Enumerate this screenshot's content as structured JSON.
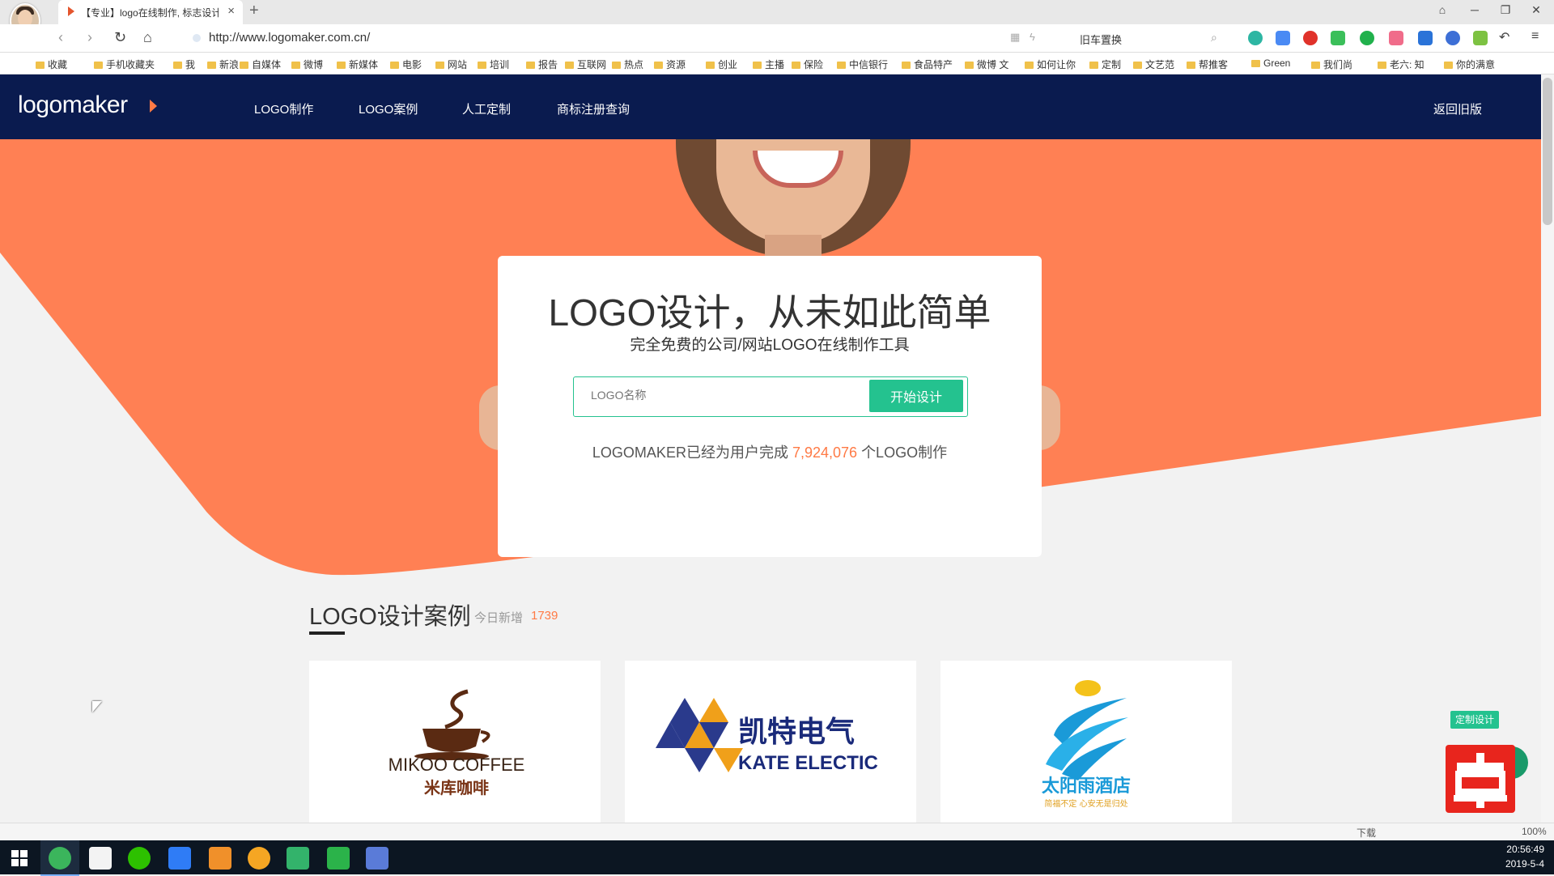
{
  "browser": {
    "tab_title": "【专业】logo在线制作, 标志设计",
    "tab_close": "×",
    "new_tab": "+",
    "url": "http://www.logomaker.com.cn/",
    "search_text": "旧车置换",
    "window_controls": {
      "pin": "⌂",
      "minimize": "─",
      "restore": "❐",
      "close": "✕"
    },
    "bookmarks": [
      "收藏",
      "手机收藏夹",
      "我",
      "新浪",
      "自媒体",
      "微博",
      "新媒体",
      "电影",
      "网站",
      "培训",
      "报告",
      "互联网",
      "热点",
      "资源",
      "创业",
      "主播",
      "保险",
      "中信银行",
      "食品特产",
      "微博 文",
      "如何让你",
      "定制",
      "文艺范",
      "帮推客",
      "Green",
      "我们尚",
      "老六: 知",
      "你的满意"
    ],
    "status": {
      "download": "下载",
      "zoom": "100%"
    }
  },
  "site": {
    "logo_text": "logomaker",
    "nav": [
      "LOGO制作",
      "LOGO案例",
      "人工定制",
      "商标注册查询"
    ],
    "old_version": "返回旧版",
    "colors": {
      "header_bg": "#0a1b4f",
      "accent_orange": "#ff7a45",
      "accent_green": "#24c28f"
    }
  },
  "hero": {
    "headline": "LOGO设计，从未如此简单",
    "subheadline": "完全免费的公司/网站LOGO在线制作工具",
    "input_placeholder": "LOGO名称",
    "start_button": "开始设计",
    "stats_prefix": "LOGOMAKER已经为用户完成",
    "stats_count": "7,924,076",
    "stats_suffix": "个LOGO制作"
  },
  "cases": {
    "title": "LOGO设计案例",
    "today_label": "今日新增",
    "today_count": "1739",
    "items": [
      {
        "brand_en": "MIKOO COFFEE",
        "brand_cn": "米库咖啡"
      },
      {
        "brand_cn": "凯特电气",
        "brand_en": "KATE ELECTIC"
      },
      {
        "brand_cn": "太阳雨酒店",
        "tagline": "简福不定 心安无是归处"
      }
    ]
  },
  "floating": {
    "custom_design": "定制设计"
  },
  "taskbar": {
    "time": "20:56:49",
    "date": "2019-5-4"
  }
}
